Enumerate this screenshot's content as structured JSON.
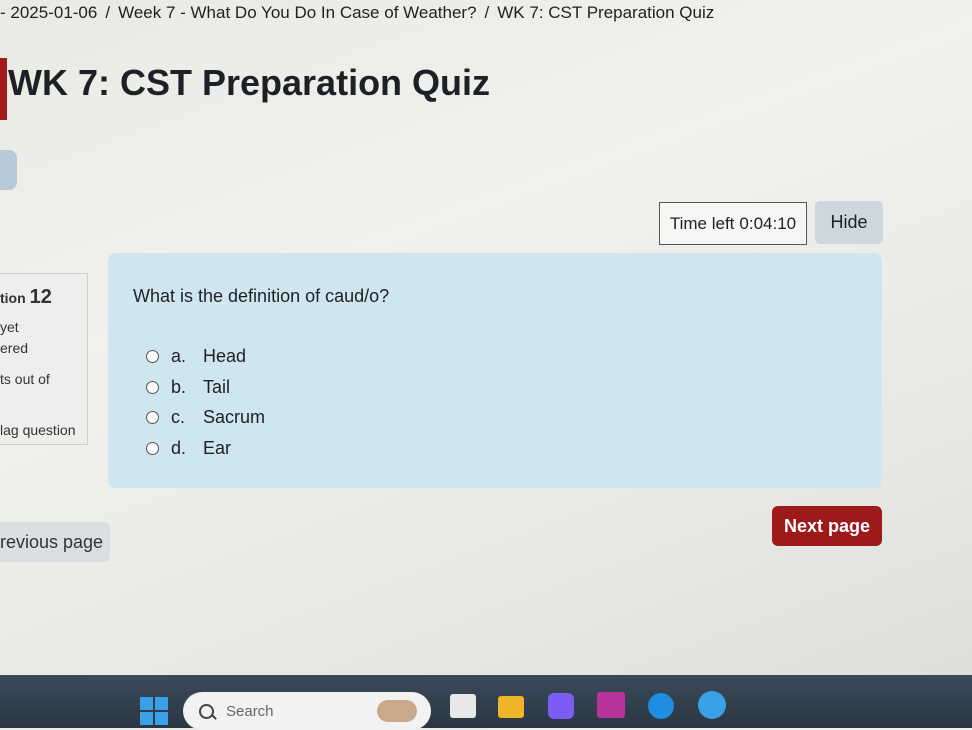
{
  "breadcrumb": {
    "items": [
      "- 2025-01-06",
      "Week 7 - What Do You Do In Case of Weather?",
      "WK 7: CST Preparation Quiz"
    ],
    "separator": "/"
  },
  "page_title": "WK 7: CST Preparation Quiz",
  "timer": {
    "label": "Time left",
    "value": "0:04:10"
  },
  "hide_label": "Hide",
  "question_info": {
    "label": "tion",
    "number": "12",
    "status_line1": "yet",
    "status_line2": "ered",
    "marks": "ts out of",
    "flag_label": "lag question"
  },
  "question": {
    "text": "What is the definition of caud/o?",
    "options": [
      {
        "letter": "a.",
        "text": "Head"
      },
      {
        "letter": "b.",
        "text": "Tail"
      },
      {
        "letter": "c.",
        "text": "Sacrum"
      },
      {
        "letter": "d.",
        "text": "Ear"
      }
    ]
  },
  "nav": {
    "prev_label": "revious page",
    "next_label": "Next page"
  },
  "taskbar": {
    "search_placeholder": "Search"
  },
  "colors": {
    "accent": "#9e1a1a",
    "question_bg": "#cfe6f0",
    "hide_bg": "#cdd7de"
  }
}
